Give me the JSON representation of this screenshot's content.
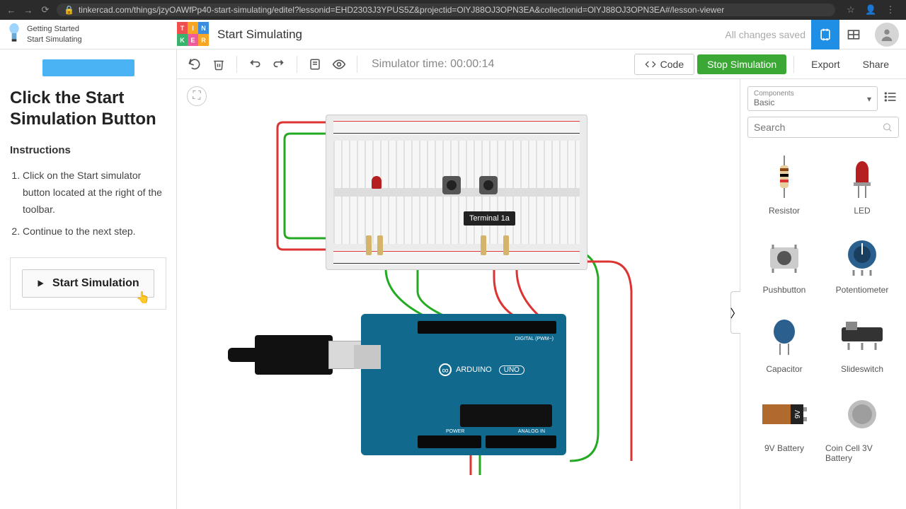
{
  "browser": {
    "url": "tinkercad.com/things/jzyOAWfPp40-start-simulating/editel?lessonid=EHD2303J3YPUS5Z&projectid=OlYJ88OJ3OPN3EA&collectionid=OlYJ88OJ3OPN3EA#/lesson-viewer"
  },
  "breadcrumb": {
    "line1": "Getting Started",
    "line2": "Start Simulating"
  },
  "page_title": "Start Simulating",
  "save_status": "All changes saved",
  "simulator_time": "Simulator time: 00:00:14",
  "toolbar": {
    "code": "Code",
    "stop_sim": "Stop Simulation",
    "export": "Export",
    "share": "Share"
  },
  "lesson": {
    "title": "Click the Start Simulation Button",
    "instructions_heading": "Instructions",
    "steps": [
      "Click on the Start simulator button located at the right of the toolbar.",
      "Continue to the next step."
    ],
    "demo_button": "Start Simulation"
  },
  "tooltip": "Terminal 1a",
  "arduino": {
    "brand": "ARDUINO",
    "model": "UNO",
    "digital": "DIGITAL (PWM~)",
    "analog": "ANALOG IN",
    "power": "POWER"
  },
  "components": {
    "heading_small": "Components",
    "selected": "Basic",
    "search_placeholder": "Search",
    "items": [
      {
        "label": "Resistor"
      },
      {
        "label": "LED"
      },
      {
        "label": "Pushbutton"
      },
      {
        "label": "Potentiometer"
      },
      {
        "label": "Capacitor"
      },
      {
        "label": "Slideswitch"
      },
      {
        "label": "9V Battery"
      },
      {
        "label": "Coin Cell 3V Battery"
      }
    ]
  },
  "logo_cells": [
    "T",
    "I",
    "N",
    "K",
    "E",
    "R"
  ],
  "logo_colors": [
    "#ef4f4f",
    "#f6a623",
    "#3a8dde",
    "#38b26c",
    "#f15a9c",
    "#f6a623"
  ]
}
